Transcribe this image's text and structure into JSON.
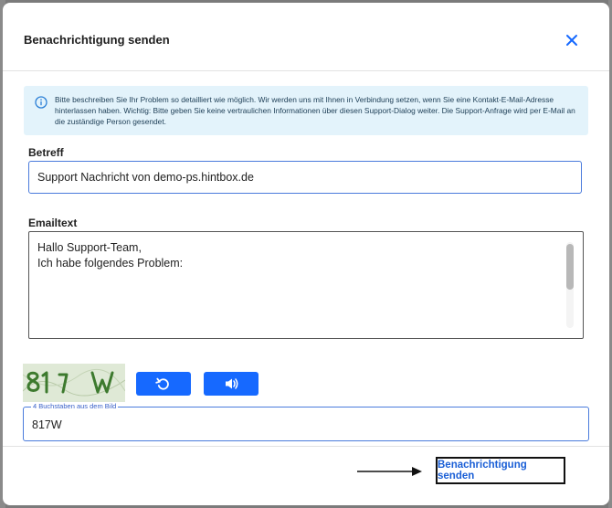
{
  "dialog": {
    "title": "Benachrichtigung senden"
  },
  "info": {
    "text": "Bitte beschreiben Sie Ihr Problem so detailliert wie möglich. Wir werden uns mit Ihnen in Verbindung setzen, wenn Sie eine Kontakt-E-Mail-Adresse hinterlassen haben. Wichtig: Bitte geben Sie keine vertraulichen Informationen über diesen Support-Dialog weiter. Die Support-Anfrage wird per E-Mail an die zuständige Person gesendet."
  },
  "subject": {
    "label": "Betreff",
    "value": "Support Nachricht von demo-ps.hintbox.de"
  },
  "email": {
    "label": "Emailtext",
    "value": "Hallo Support-Team,\nIch habe folgendes Problem:"
  },
  "captcha": {
    "image_text": "817W",
    "field_label": "4 Buchstaben aus dem Bild",
    "value": "817W"
  },
  "footer": {
    "send_label": "Benachrichtigung senden"
  },
  "icons": {
    "close": "close-icon",
    "info": "info-icon",
    "refresh": "refresh-icon",
    "audio": "speaker-icon",
    "arrow": "arrow-right-icon"
  },
  "colors": {
    "accent": "#1669ff",
    "info_bg": "#e3f3fb",
    "link_text": "#1a5fd6"
  }
}
